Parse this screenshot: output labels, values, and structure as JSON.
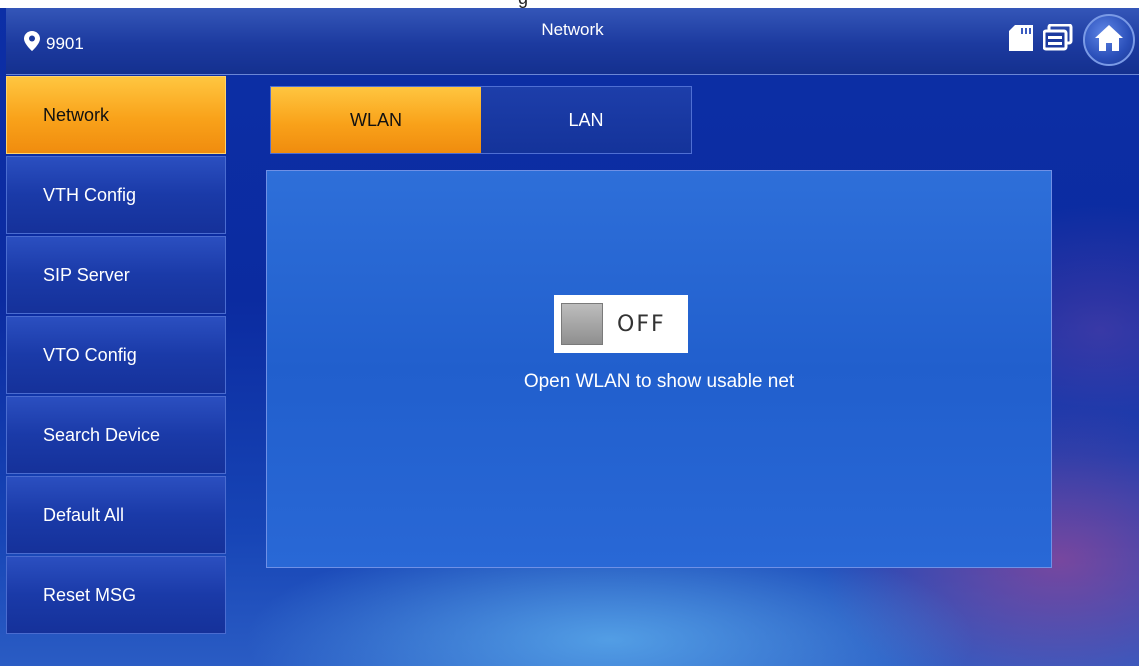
{
  "page": {
    "top_fragment": "g"
  },
  "status_bar": {
    "location_icon": "map-pin-icon",
    "location_id": "9901",
    "title": "Network",
    "icons": [
      "sd-card-icon",
      "message-icon",
      "home-icon"
    ]
  },
  "sidebar": {
    "items": [
      {
        "label": "Network",
        "active": true
      },
      {
        "label": "VTH Config",
        "active": false
      },
      {
        "label": "SIP Server",
        "active": false
      },
      {
        "label": "VTO Config",
        "active": false
      },
      {
        "label": "Search Device",
        "active": false
      },
      {
        "label": "Default All",
        "active": false
      },
      {
        "label": "Reset MSG",
        "active": false
      }
    ]
  },
  "tabs": [
    {
      "label": "WLAN",
      "active": true
    },
    {
      "label": "LAN",
      "active": false
    }
  ],
  "wlan": {
    "toggle_state": "OFF",
    "hint": "Open WLAN to show usable net"
  },
  "colors": {
    "accent_active": "#f9a21a",
    "background": "#0c2fa6",
    "panel": "#2e6fd9"
  }
}
